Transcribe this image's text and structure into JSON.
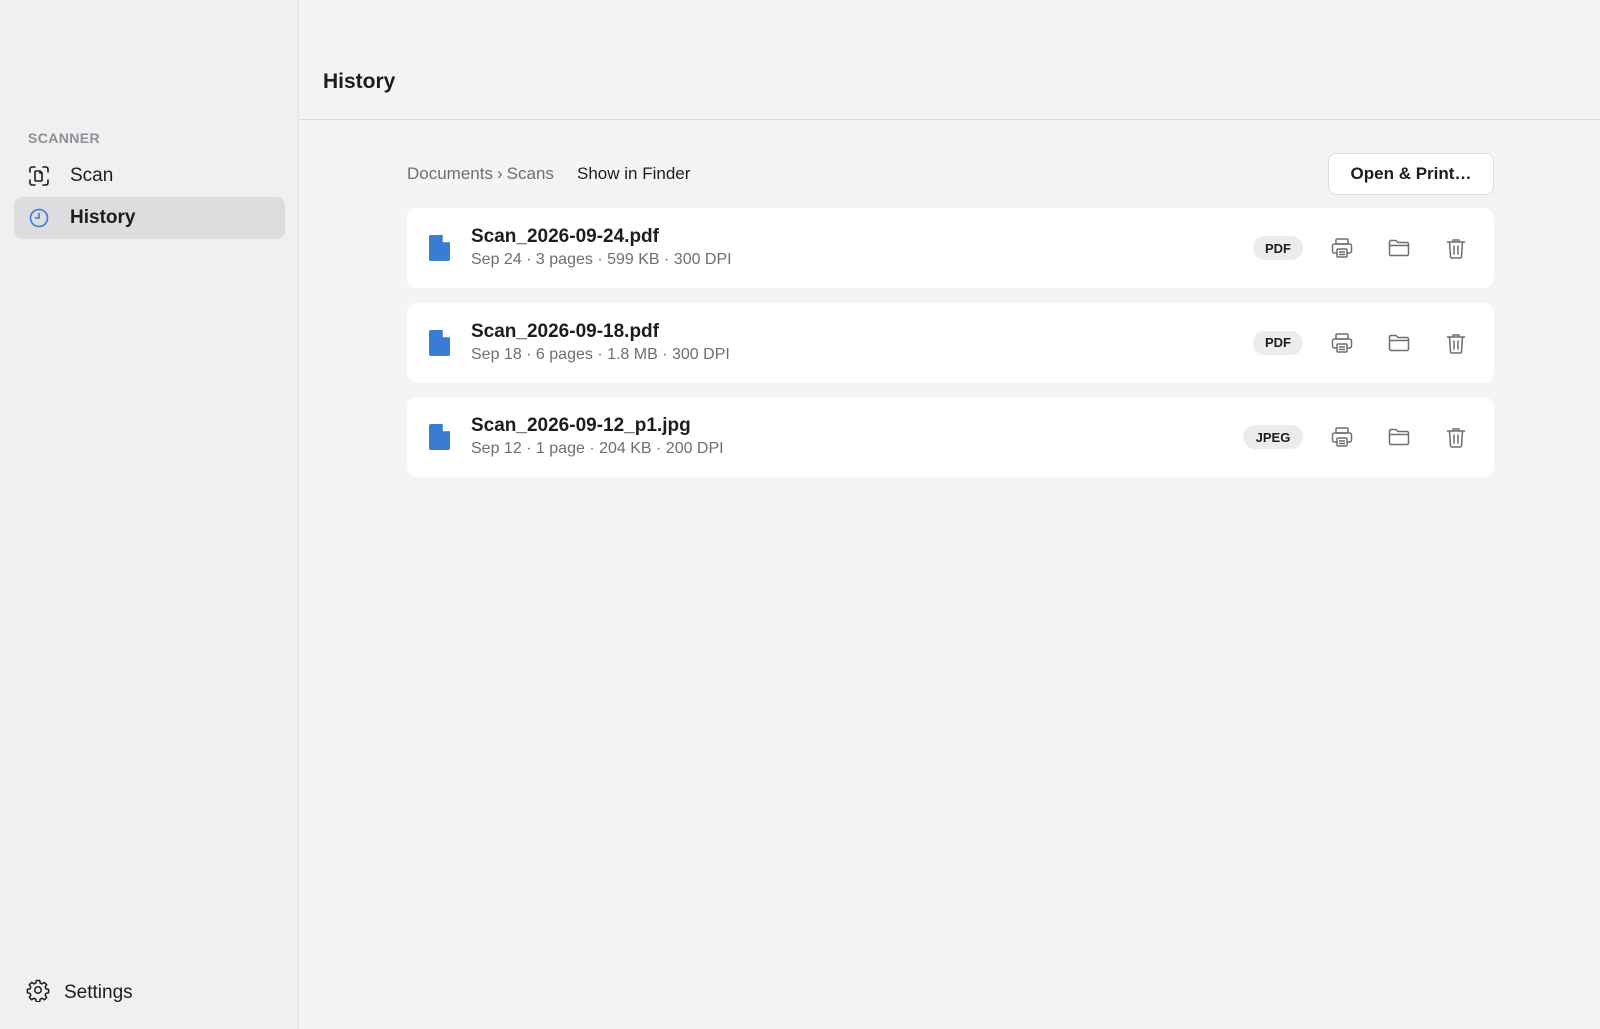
{
  "sidebar": {
    "section_label": "SCANNER",
    "items": [
      {
        "label": "Scan",
        "icon": "scan-icon"
      },
      {
        "label": "History",
        "icon": "clock-icon",
        "selected": true
      }
    ],
    "settings_label": "Settings"
  },
  "header": {
    "title": "History"
  },
  "toolbar": {
    "breadcrumb": [
      "Documents",
      "Scans"
    ],
    "breadcrumb_separator": "›",
    "show_in_finder": "Show in Finder",
    "open_print": "Open & Print…"
  },
  "files": [
    {
      "name": "Scan_2026-09-24.pdf",
      "meta": "Sep 24 · 3 pages · 599 KB · 300 DPI",
      "format": "PDF"
    },
    {
      "name": "Scan_2026-09-18.pdf",
      "meta": "Sep 18 · 6 pages · 1.8 MB · 300 DPI",
      "format": "PDF"
    },
    {
      "name": "Scan_2026-09-12_p1.jpg",
      "meta": "Sep 12 · 1 page · 204 KB · 200 DPI",
      "format": "JPEG"
    }
  ],
  "colors": {
    "accent": "#3a7bd5",
    "sidebar_bg": "#f0f0f2",
    "selected_bg": "#dddde0",
    "main_bg": "#f4f4f6",
    "card_bg": "#ffffff",
    "icon_gray": "#6e6e73"
  }
}
